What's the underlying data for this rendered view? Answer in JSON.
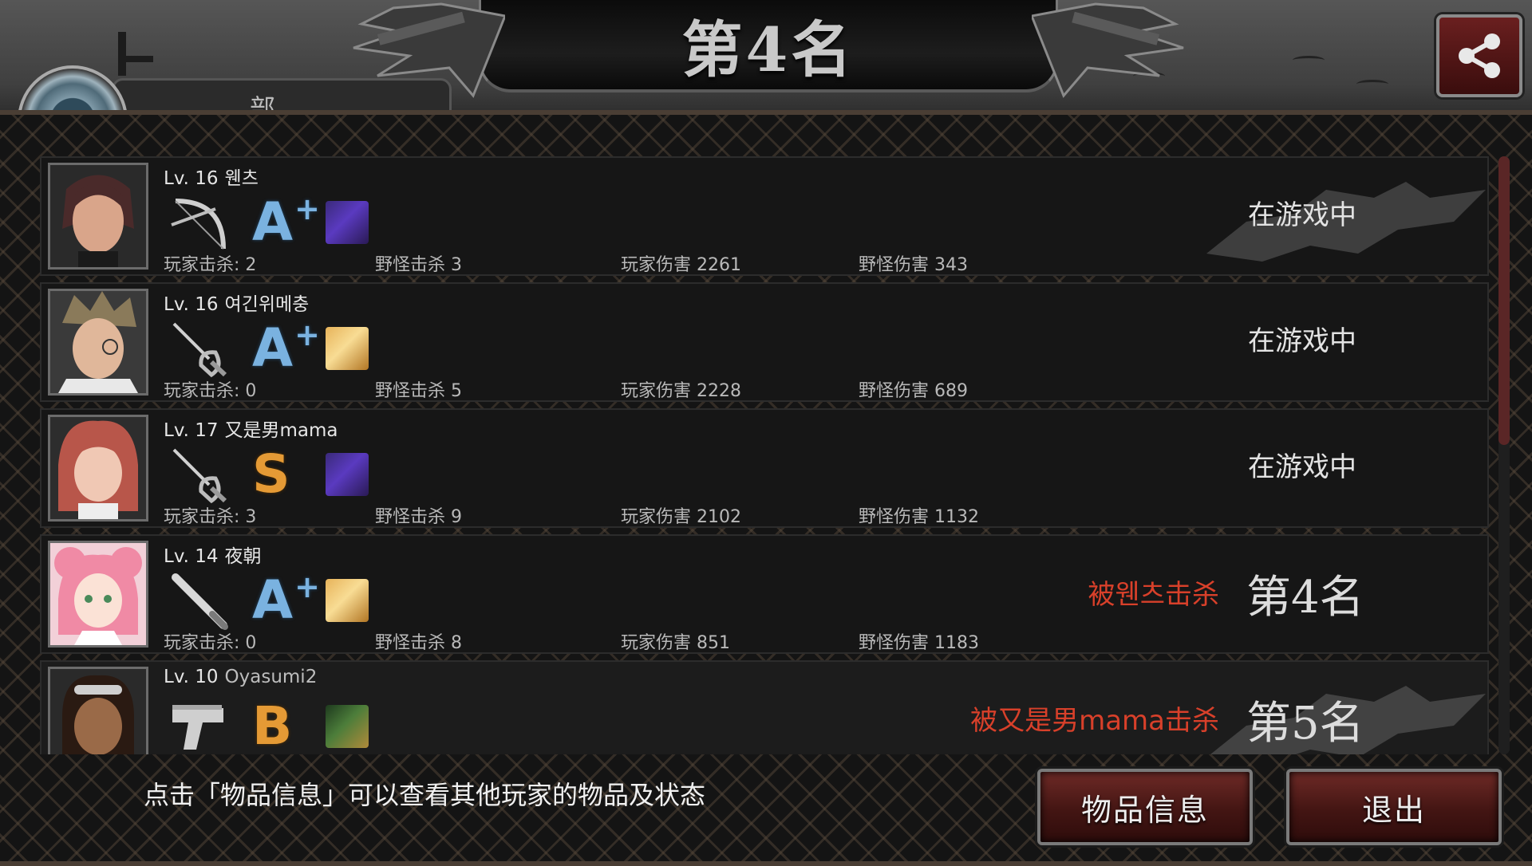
{
  "header": {
    "title": "第4名",
    "tab_label": "部"
  },
  "players": [
    {
      "level": "Lv. 16",
      "name": "웬츠",
      "weapon_icon": "bow-icon",
      "grade": "A",
      "grade_suffix": "+",
      "grade_color": "#7ab2e0",
      "item_icon": "purple-gear-icon",
      "stats": {
        "player_kills": "玩家击杀: 2",
        "monster_kills": "野怪击杀 3",
        "player_damage": "玩家伤害 2261",
        "monster_damage": "野怪伤害 343"
      },
      "status": "在游戏中",
      "killed_by": "",
      "rank": ""
    },
    {
      "level": "Lv. 16",
      "name": "여긴위메충",
      "weapon_icon": "rapier-icon",
      "grade": "A",
      "grade_suffix": "+",
      "grade_color": "#7ab2e0",
      "item_icon": "bread-icon",
      "stats": {
        "player_kills": "玩家击杀: 0",
        "monster_kills": "野怪击杀 5",
        "player_damage": "玩家伤害 2228",
        "monster_damage": "野怪伤害 689"
      },
      "status": "在游戏中",
      "killed_by": "",
      "rank": ""
    },
    {
      "level": "Lv. 17",
      "name": "又是男mama",
      "weapon_icon": "rapier-icon",
      "grade": "S",
      "grade_suffix": "",
      "grade_color": "#e59a35",
      "item_icon": "purple-gear-icon",
      "stats": {
        "player_kills": "玩家击杀: 3",
        "monster_kills": "野怪击杀 9",
        "player_damage": "玩家伤害 2102",
        "monster_damage": "野怪伤害 1132"
      },
      "status": "在游戏中",
      "killed_by": "",
      "rank": ""
    },
    {
      "level": "Lv. 14",
      "name": "夜朝",
      "weapon_icon": "bat-icon",
      "grade": "A",
      "grade_suffix": "+",
      "grade_color": "#7ab2e0",
      "item_icon": "bread-icon",
      "stats": {
        "player_kills": "玩家击杀: 0",
        "monster_kills": "野怪击杀 8",
        "player_damage": "玩家伤害 851",
        "monster_damage": "野怪伤害 1183"
      },
      "status": "",
      "killed_by": "被웬츠击杀",
      "rank": "第4名"
    },
    {
      "level": "Lv. 10",
      "name": "Oyasumi2",
      "weapon_icon": "pistol-icon",
      "grade": "B",
      "grade_suffix": "",
      "grade_color": "#e59a35",
      "item_icon": "portrait-card-icon",
      "stats": {
        "player_kills": "",
        "monster_kills": "",
        "player_damage": "",
        "monster_damage": ""
      },
      "status": "",
      "killed_by": "被又是男mama击杀",
      "rank": "第5名"
    }
  ],
  "footer": {
    "hint": "点击「物品信息」可以查看其他玩家的物品及状态",
    "item_info_label": "物品信息",
    "exit_label": "退出"
  },
  "colors": {
    "killed_text": "#d8402a",
    "button_red": "#6e2a26",
    "grade_blue": "#7ab2e0",
    "grade_orange": "#e59a35"
  }
}
